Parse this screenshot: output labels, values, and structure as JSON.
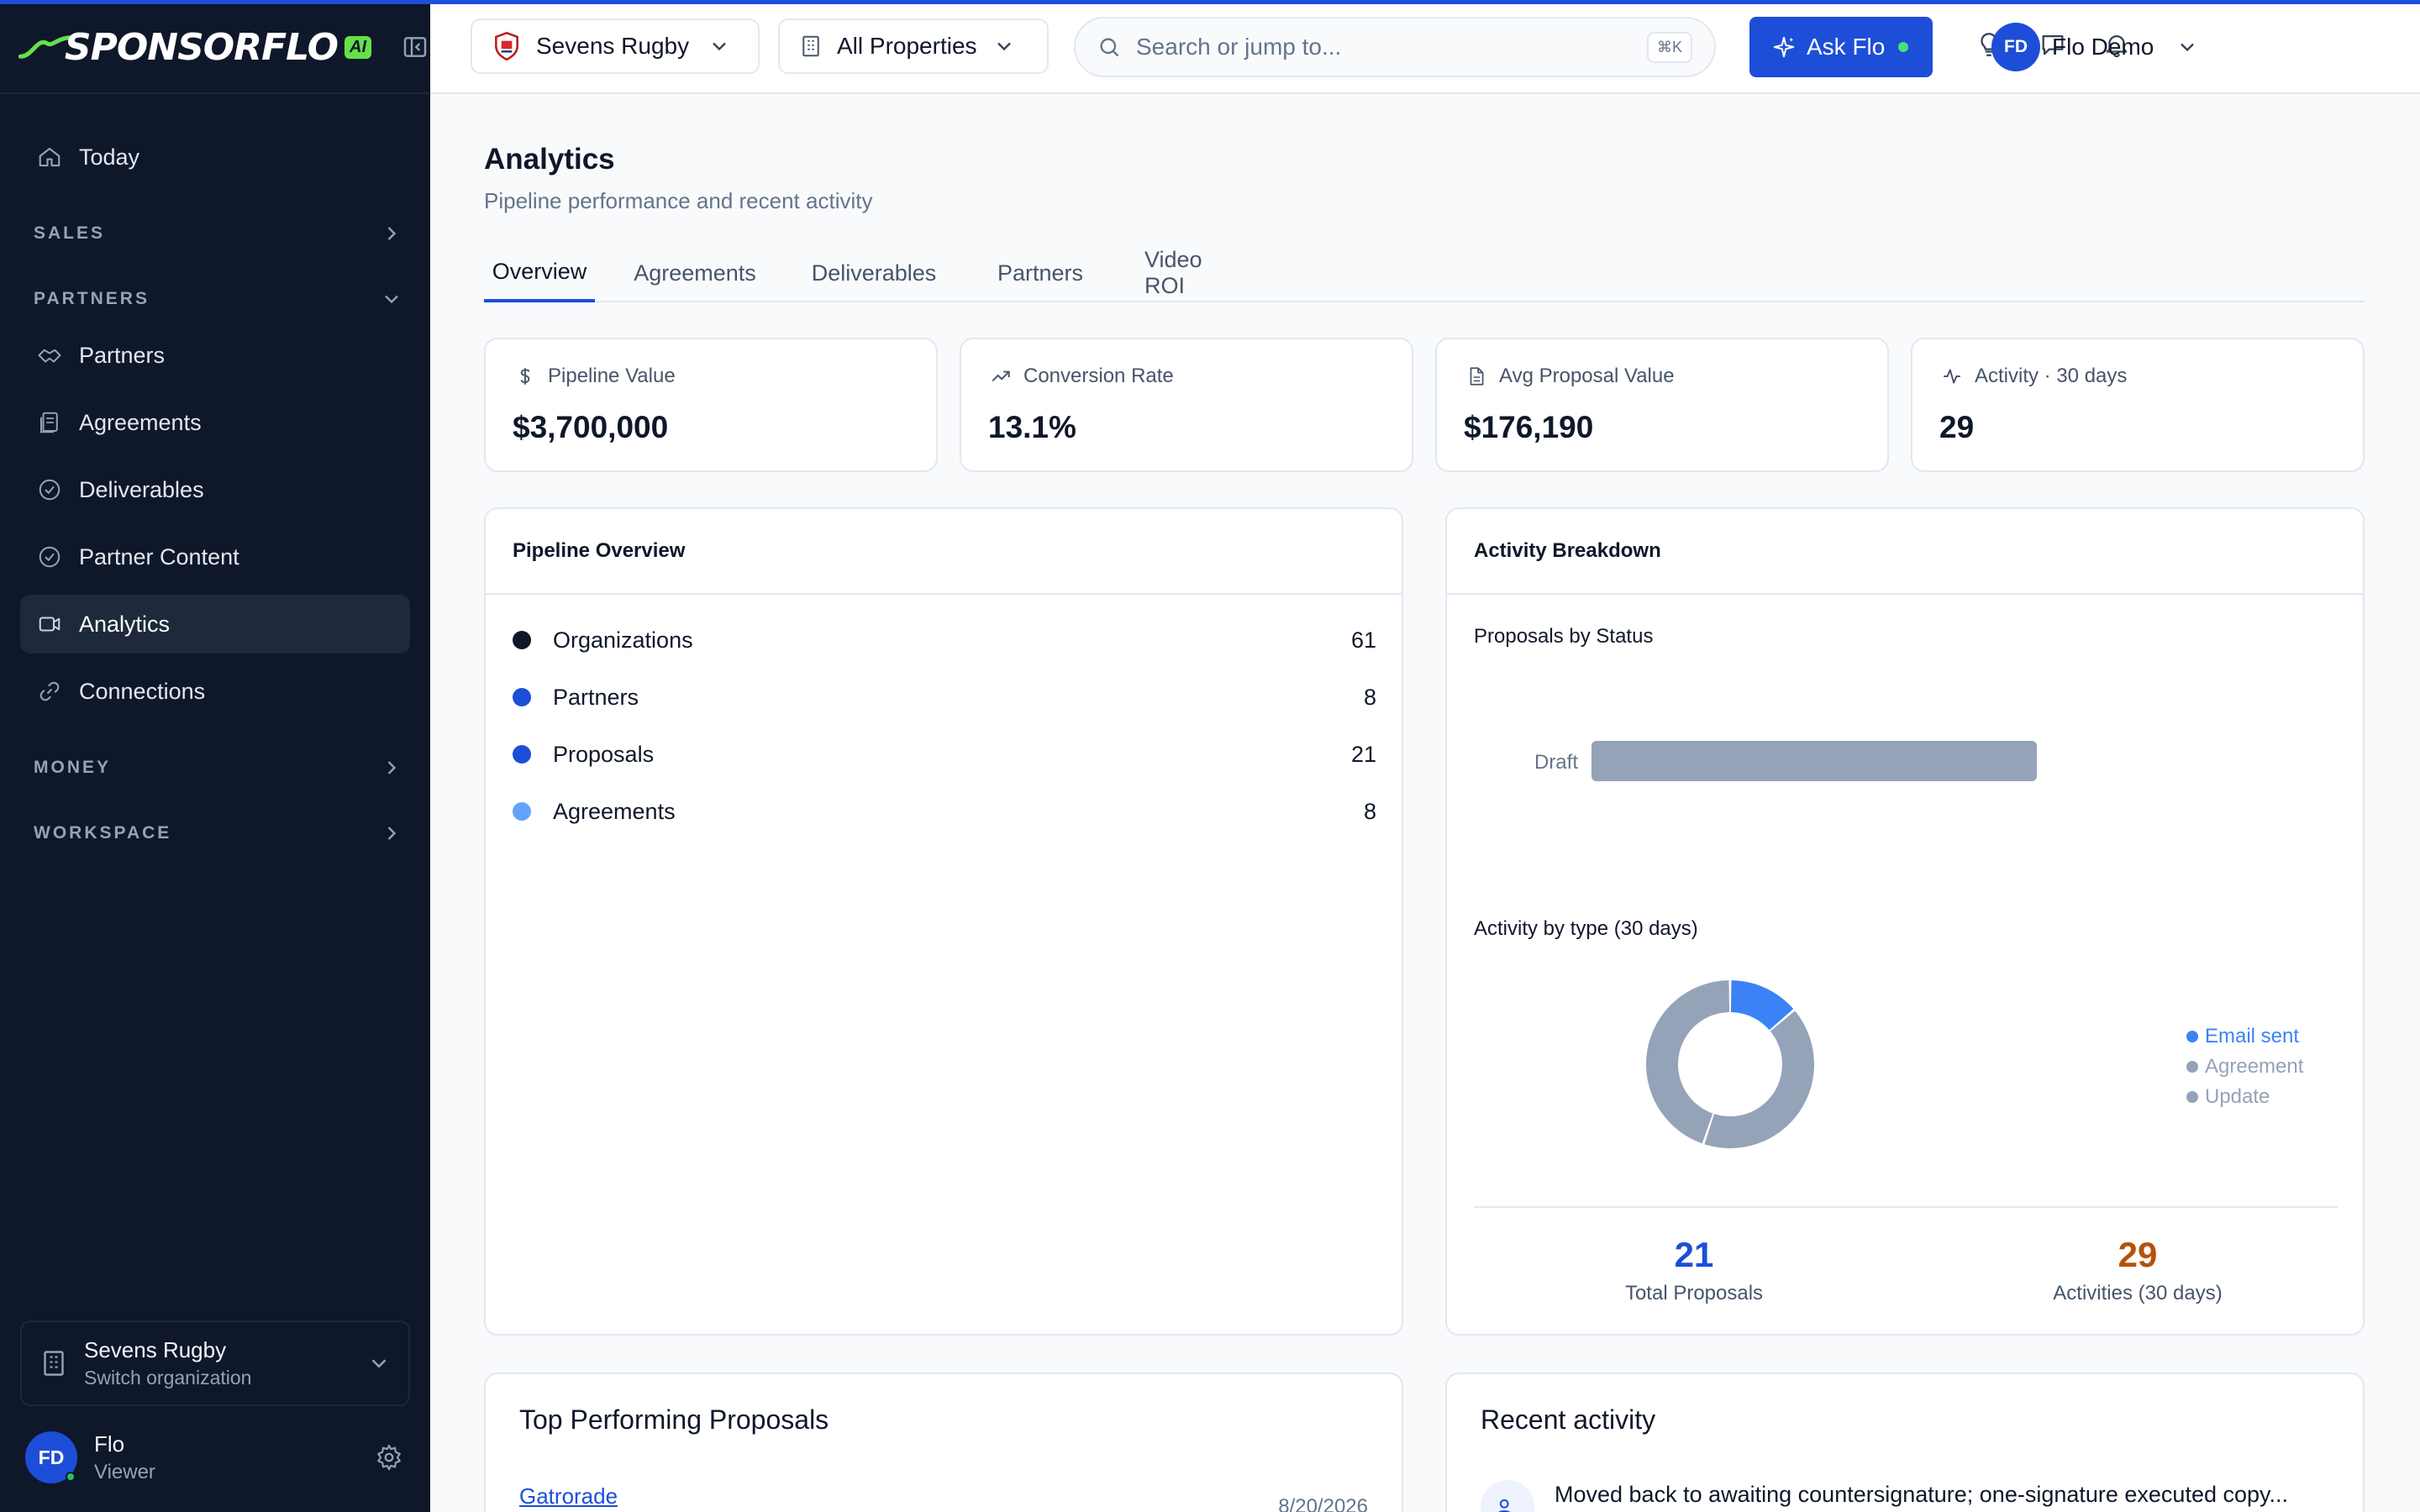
{
  "sidebar": {
    "brand": "SPONSORFLO",
    "brand_badge": "AI",
    "items": {
      "today": "Today",
      "partners": "Partners",
      "agreements": "Agreements",
      "deliverables": "Deliverables",
      "partner_content": "Partner Content",
      "analytics": "Analytics",
      "connections": "Connections"
    },
    "sections": {
      "sales": "SALES",
      "partners": "PARTNERS",
      "money": "MONEY",
      "workspace": "WORKSPACE"
    },
    "org": {
      "name": "Sevens Rugby",
      "subtitle": "Switch organization"
    },
    "user": {
      "initials": "FD",
      "name": "Flo",
      "role": "Viewer"
    }
  },
  "topbar": {
    "org_select": "Sevens Rugby",
    "property_select": "All Properties",
    "search_placeholder": "Search or jump to...",
    "search_shortcut": "⌘K",
    "ask_button": "Ask Flo",
    "user": {
      "initials": "FD",
      "name": "Flo Demo"
    }
  },
  "page": {
    "title": "Analytics",
    "subtitle": "Pipeline performance and recent activity",
    "tabs": [
      "Overview",
      "Agreements",
      "Deliverables",
      "Partners",
      "Video ROI"
    ]
  },
  "stats": [
    {
      "label": "Pipeline Value",
      "value": "$3,700,000"
    },
    {
      "label": "Conversion Rate",
      "value": "13.1%"
    },
    {
      "label": "Avg Proposal Value",
      "value": "$176,190"
    },
    {
      "label": "Activity · 30 days",
      "value": "29"
    }
  ],
  "pipeline": {
    "title": "Pipeline Overview",
    "rows": [
      {
        "name": "Organizations",
        "count": "61",
        "color": "#0f172a"
      },
      {
        "name": "Partners",
        "count": "8",
        "color": "#1d4ed8"
      },
      {
        "name": "Proposals",
        "count": "21",
        "color": "#1d4ed8"
      },
      {
        "name": "Agreements",
        "count": "8",
        "color": "#60a5fa"
      }
    ]
  },
  "breakdown": {
    "title": "Activity Breakdown",
    "proposals_title": "Proposals by Status",
    "activity_title": "Activity by type (30 days)",
    "total_proposals": "21",
    "total_proposals_label": "Total Proposals",
    "activities": "29",
    "activities_label": "Activities (30 days)"
  },
  "chart_data": [
    {
      "type": "bar",
      "orientation": "horizontal",
      "title": "Proposals by Status",
      "categories": [
        "Draft"
      ],
      "values": [
        21
      ],
      "color": "#94a3b8"
    },
    {
      "type": "pie",
      "title": "Activity by type (30 days)",
      "labels": [
        "Email sent",
        "Agreement",
        "Update"
      ],
      "values": [
        4,
        12,
        13
      ],
      "colors": [
        "#3b82f6",
        "#94a3b8",
        "#94a3b8"
      ],
      "legend": "right"
    }
  ],
  "top_proposals": {
    "title": "Top Performing Proposals",
    "first_name": "Gatrorade",
    "first_date": "8/20/2026"
  },
  "recent_activity": {
    "title": "Recent activity",
    "first_text": "Moved back to awaiting countersignature; one-signature executed copy..."
  },
  "colors": {
    "accent": "#1d4ed8",
    "sidebar_bg": "#0f172a",
    "brand_green": "#65e04a",
    "activities_orange": "#b45309"
  }
}
